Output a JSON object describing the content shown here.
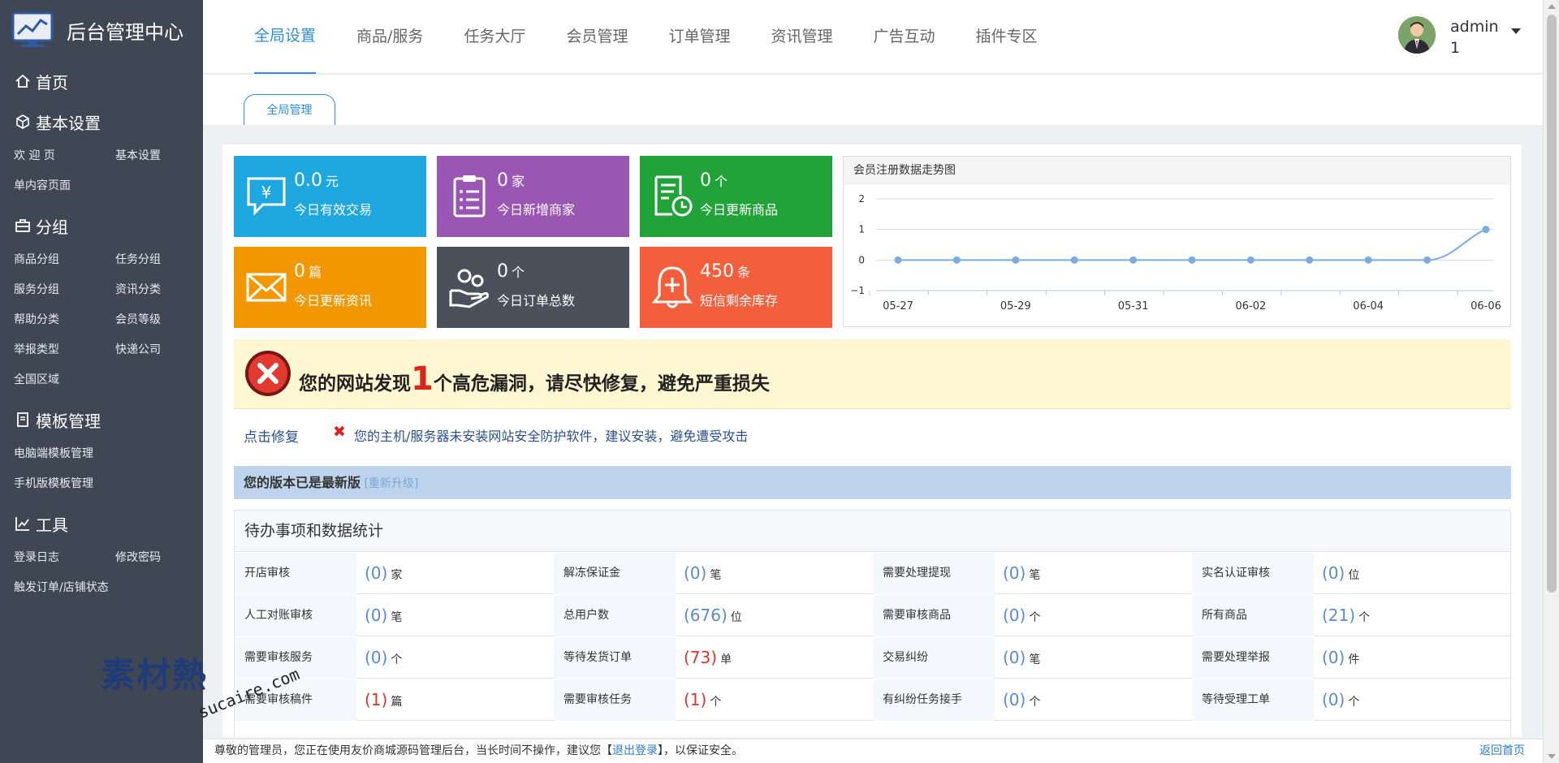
{
  "app": {
    "title": "后台管理中心"
  },
  "sidebar": {
    "sections": [
      {
        "label": "首页",
        "icon": "home-icon",
        "links": []
      },
      {
        "label": "基本设置",
        "icon": "cube-icon",
        "links": [
          "欢 迎 页",
          "基本设置",
          "单内容页面"
        ]
      },
      {
        "label": "分组",
        "icon": "briefcase-icon",
        "links": [
          "商品分组",
          "任务分组",
          "服务分组",
          "资讯分类",
          "帮助分类",
          "会员等级",
          "举报类型",
          "快递公司",
          "全国区域"
        ]
      },
      {
        "label": "模板管理",
        "icon": "document-icon",
        "links": [
          "电脑端模板管理",
          "手机版模板管理"
        ]
      },
      {
        "label": "工具",
        "icon": "line-chart-icon",
        "links": [
          "登录日志",
          "修改密码",
          "触发订单/店铺状态"
        ]
      }
    ]
  },
  "topnav": {
    "tabs": [
      "全局设置",
      "商品/服务",
      "任务大厅",
      "会员管理",
      "订单管理",
      "资讯管理",
      "广告互动",
      "插件专区"
    ],
    "active": 0
  },
  "user": {
    "name": "admin",
    "badge": "1"
  },
  "subnav": {
    "tab": "全局管理"
  },
  "tiles": [
    {
      "value": "0.0",
      "unit": "元",
      "label": "今日有效交易",
      "color": "#1fa8e0",
      "icon": "yen-chat-icon"
    },
    {
      "value": "0",
      "unit": "家",
      "label": "今日新增商家",
      "color": "#9957b3",
      "icon": "clipboard-list-icon"
    },
    {
      "value": "0",
      "unit": "个",
      "label": "今日更新商品",
      "color": "#22a339",
      "icon": "document-clock-icon"
    },
    {
      "value": "0",
      "unit": "篇",
      "label": "今日更新资讯",
      "color": "#f29702",
      "icon": "envelope-icon"
    },
    {
      "value": "0",
      "unit": "个",
      "label": "今日订单总数",
      "color": "#4a515b",
      "icon": "hand-coins-icon"
    },
    {
      "value": "450",
      "unit": "条",
      "label": "短信剩余库存",
      "color": "#f35f3d",
      "icon": "bell-icon"
    }
  ],
  "chart_data": {
    "type": "line",
    "title": "会员注册数据走势图",
    "x": [
      "05-27",
      "05-28",
      "05-29",
      "05-30",
      "05-31",
      "06-01",
      "06-02",
      "06-03",
      "06-04",
      "06-05",
      "06-06"
    ],
    "x_tick_labels": [
      "05-27",
      "05-29",
      "05-31",
      "06-02",
      "06-04",
      "06-06"
    ],
    "series": [
      {
        "values": [
          0,
          0,
          0,
          0,
          0,
          0,
          0,
          0,
          0,
          0,
          1
        ],
        "color": "#7aaddd"
      }
    ],
    "ylim": [
      -1,
      2
    ],
    "y_ticks": [
      "2",
      "1",
      "0",
      "−1"
    ],
    "grid": true
  },
  "alert": {
    "prefix": "您的网站发现",
    "count": "1",
    "suffix": "个高危漏洞，请尽快修复，避免严重损失",
    "fix_link": "点击修复",
    "warning_mark": "✖",
    "warning": "您的主机/服务器未安装网站安全防护软件，建议安装，避免遭受攻击"
  },
  "version": {
    "text": "您的版本已是最新版",
    "upgrade": "[重新升级]"
  },
  "todo": {
    "title": "待办事项和数据统计",
    "rows": [
      [
        {
          "k": "开店审核",
          "v": "(0)",
          "u": "家"
        },
        {
          "k": "解冻保证金",
          "v": "(0)",
          "u": "笔"
        },
        {
          "k": "需要处理提现",
          "v": "(0)",
          "u": "笔"
        },
        {
          "k": "实名认证审核",
          "v": "(0)",
          "u": "位"
        }
      ],
      [
        {
          "k": "人工对账审核",
          "v": "(0)",
          "u": "笔"
        },
        {
          "k": "总用户数",
          "v": "(676)",
          "u": "位"
        },
        {
          "k": "需要审核商品",
          "v": "(0)",
          "u": "个"
        },
        {
          "k": "所有商品",
          "v": "(21)",
          "u": "个"
        }
      ],
      [
        {
          "k": "需要审核服务",
          "v": "(0)",
          "u": "个"
        },
        {
          "k": "等待发货订单",
          "v": "(73)",
          "u": "单",
          "red": true
        },
        {
          "k": "交易纠纷",
          "v": "(0)",
          "u": "笔"
        },
        {
          "k": "需要处理举报",
          "v": "(0)",
          "u": "件"
        }
      ],
      [
        {
          "k": "需要审核稿件",
          "v": "(1)",
          "u": "篇",
          "red": true
        },
        {
          "k": "需要审核任务",
          "v": "(1)",
          "u": "个",
          "red": true
        },
        {
          "k": "有纠纷任务接手",
          "v": "(0)",
          "u": "个"
        },
        {
          "k": "等待受理工单",
          "v": "(0)",
          "u": "个"
        }
      ]
    ]
  },
  "footer": {
    "text_before": "尊敬的管理员，您正在使用友价商城源码管理后台，当长时间不操作，建议您【",
    "logout": "退出登录",
    "text_after": "】，以保证安全。",
    "home": "返回首页"
  },
  "watermark": {
    "cn": "素材熱",
    "en": "sucaire.com"
  }
}
